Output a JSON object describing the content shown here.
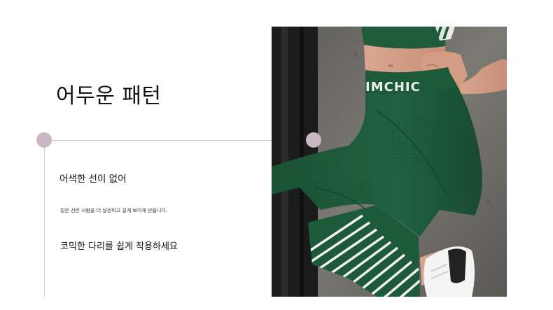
{
  "title": "어두운 패턴",
  "subheading": "어색한 선이 없어",
  "description": "짙은 선은 사람을 더 날씬하고 길게 보이게 만듭니다.",
  "tagline": "코믹한 다리를 쉽게 착용하세요",
  "photo": {
    "waistband_text": "IMCHIC"
  },
  "colors": {
    "accent_dot": "#cbb7c3",
    "line": "#c7b6be",
    "legging_green": "#1e5b3a"
  }
}
